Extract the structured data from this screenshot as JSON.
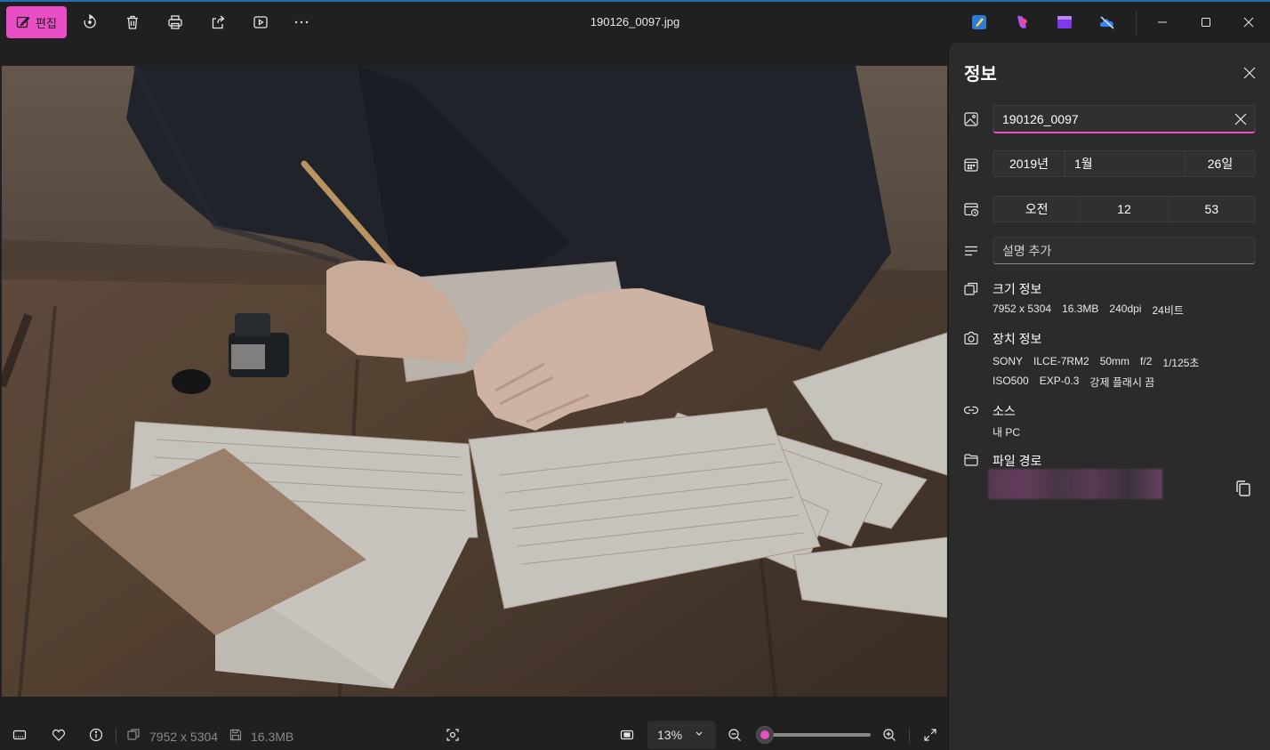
{
  "toolbar": {
    "edit_label": "편집",
    "file_name": "190126_0097.jpg"
  },
  "info_panel": {
    "title": "정보",
    "name_value": "190126_0097",
    "date": {
      "year": "2019년",
      "month": "1월",
      "day": "26일"
    },
    "time": {
      "ampm": "오전",
      "hour": "12",
      "minute": "53"
    },
    "description_placeholder": "설명 추가",
    "size_section": {
      "title": "크기 정보",
      "dimensions": "7952 x 5304",
      "filesize": "16.3MB",
      "dpi": "240dpi",
      "bitdepth": "24비트"
    },
    "device_section": {
      "title": "장치 정보",
      "make": "SONY",
      "model": "ILCE-7RM2",
      "focal": "50mm",
      "aperture": "f/2",
      "shutter": "1/125초",
      "iso": "ISO500",
      "exposure": "EXP-0.3",
      "flash": "강제 플래시 끔"
    },
    "source_section": {
      "title": "소스",
      "value": "내 PC"
    },
    "path_section": {
      "title": "파일 경로"
    }
  },
  "bottombar": {
    "dimensions": "7952 x 5304",
    "filesize": "16.3MB",
    "zoom": "13%",
    "zoom_level": 0.06
  },
  "colors": {
    "accent": "#e94ec7",
    "background": "#202020",
    "panel": "#2b2b2b"
  }
}
